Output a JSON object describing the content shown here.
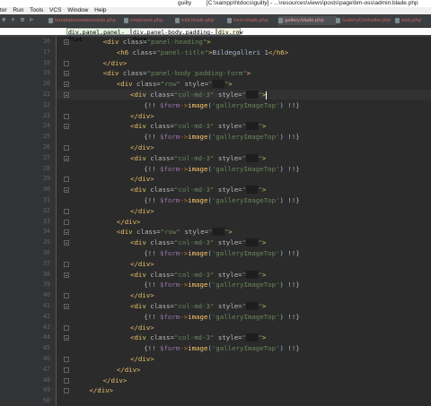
{
  "title_bar": {
    "project": "guilty",
    "path": "[C:\\xampp\\htdocs\\guilty] - ...\\resources\\views\\posts\\page\\bm-oss\\admin.blade.php"
  },
  "menu": [
    "tor",
    "Run",
    "Tools",
    "VCS",
    "Window",
    "Help"
  ],
  "tabs": [
    {
      "label": "templates/webmodule.php",
      "active": false
    },
    {
      "label": "employee.php",
      "active": false
    },
    {
      "label": "edit.blade.php",
      "active": false
    },
    {
      "label": "form.blade.php",
      "active": false
    },
    {
      "label": "gallery.blade.php",
      "active": true
    },
    {
      "label": "GalleryController.php",
      "active": false
    },
    {
      "label": "web.php",
      "active": false
    }
  ],
  "breadcrumb": [
    "div.panel.panel-flat",
    "div.panel-body.padding-form",
    "div.row"
  ],
  "lines": [
    {
      "n": "16",
      "fold": "open",
      "indent": 3,
      "parts": [
        [
          "tag",
          "<div "
        ],
        [
          "attr",
          "class="
        ],
        [
          "str",
          "\"panel-heading\""
        ],
        [
          "tag",
          ">"
        ]
      ]
    },
    {
      "n": "17",
      "fold": "",
      "indent": 4,
      "parts": [
        [
          "tag",
          "<h6 "
        ],
        [
          "attr",
          "class="
        ],
        [
          "str",
          "\"panel-title\""
        ],
        [
          "tag",
          ">"
        ],
        [
          "txt",
          "Bildegalleri 1"
        ],
        [
          "tag",
          "</h6>"
        ]
      ]
    },
    {
      "n": "18",
      "fold": "close",
      "indent": 3,
      "parts": [
        [
          "tag",
          "</div>"
        ]
      ]
    },
    {
      "n": "19",
      "fold": "open",
      "indent": 3,
      "parts": [
        [
          "tag",
          "<div "
        ],
        [
          "attr",
          "class="
        ],
        [
          "str",
          "\"panel-body padding-form\""
        ],
        [
          "tag",
          ">"
        ]
      ]
    },
    {
      "n": "20",
      "fold": "open",
      "indent": 4,
      "parts": [
        [
          "tag",
          "<div "
        ],
        [
          "attr",
          "class="
        ],
        [
          "str",
          "\"row\" "
        ],
        [
          "attr",
          "style="
        ],
        [
          "str",
          "\""
        ],
        [
          "dark",
          "███"
        ],
        [
          "str",
          "\""
        ],
        [
          "tag",
          ">"
        ]
      ]
    },
    {
      "n": "21",
      "fold": "open",
      "indent": 5,
      "cursor": true,
      "parts": [
        [
          "tag",
          "<div "
        ],
        [
          "attr",
          "class="
        ],
        [
          "str",
          "\"col-md-3\" "
        ],
        [
          "attr",
          "style="
        ],
        [
          "str",
          "\""
        ],
        [
          "dark",
          "███"
        ],
        [
          "str",
          "\""
        ],
        [
          "tag",
          ">"
        ]
      ]
    },
    {
      "n": "22",
      "fold": "",
      "indent": 6,
      "parts": [
        [
          "bang",
          "{!! "
        ],
        [
          "var",
          "$form"
        ],
        [
          "arrow",
          "->"
        ],
        [
          "fn",
          "image"
        ],
        [
          "txt",
          "("
        ],
        [
          "str",
          "'galleryImageTop'"
        ],
        [
          "txt",
          ") !!}"
        ]
      ]
    },
    {
      "n": "23",
      "fold": "close",
      "indent": 5,
      "parts": [
        [
          "tag",
          "</div>"
        ]
      ]
    },
    {
      "n": "24",
      "fold": "open",
      "indent": 5,
      "parts": [
        [
          "tag",
          "<div "
        ],
        [
          "attr",
          "class="
        ],
        [
          "str",
          "\"col-md-3\" "
        ],
        [
          "attr",
          "style="
        ],
        [
          "str",
          "\""
        ],
        [
          "dark",
          "███"
        ],
        [
          "str",
          "\""
        ],
        [
          "tag",
          ">"
        ]
      ]
    },
    {
      "n": "25",
      "fold": "",
      "indent": 6,
      "parts": [
        [
          "bang",
          "{!! "
        ],
        [
          "var",
          "$form"
        ],
        [
          "arrow",
          "->"
        ],
        [
          "fn",
          "image"
        ],
        [
          "txt",
          "("
        ],
        [
          "str",
          "'galleryImageTop'"
        ],
        [
          "txt",
          ") !!}"
        ]
      ]
    },
    {
      "n": "26",
      "fold": "close",
      "indent": 5,
      "parts": [
        [
          "tag",
          "</div>"
        ]
      ]
    },
    {
      "n": "27",
      "fold": "open",
      "indent": 5,
      "parts": [
        [
          "tag",
          "<div "
        ],
        [
          "attr",
          "class="
        ],
        [
          "str",
          "\"col-md-3\" "
        ],
        [
          "attr",
          "style="
        ],
        [
          "str",
          "\""
        ],
        [
          "dark",
          "███"
        ],
        [
          "str",
          "\""
        ],
        [
          "tag",
          ">"
        ]
      ]
    },
    {
      "n": "28",
      "fold": "",
      "indent": 6,
      "parts": [
        [
          "bang",
          "{!! "
        ],
        [
          "var",
          "$form"
        ],
        [
          "arrow",
          "->"
        ],
        [
          "fn",
          "image"
        ],
        [
          "txt",
          "("
        ],
        [
          "str",
          "'galleryImageTop'"
        ],
        [
          "txt",
          ") !!}"
        ]
      ]
    },
    {
      "n": "29",
      "fold": "close",
      "indent": 5,
      "parts": [
        [
          "tag",
          "</div>"
        ]
      ]
    },
    {
      "n": "30",
      "fold": "open",
      "indent": 5,
      "parts": [
        [
          "tag",
          "<div "
        ],
        [
          "attr",
          "class="
        ],
        [
          "str",
          "\"col-md-3\" "
        ],
        [
          "attr",
          "style="
        ],
        [
          "str",
          "\""
        ],
        [
          "dark",
          "███"
        ],
        [
          "str",
          "\""
        ],
        [
          "tag",
          ">"
        ]
      ]
    },
    {
      "n": "31",
      "fold": "",
      "indent": 6,
      "parts": [
        [
          "bang",
          "{!! "
        ],
        [
          "var",
          "$form"
        ],
        [
          "arrow",
          "->"
        ],
        [
          "fn",
          "image"
        ],
        [
          "txt",
          "("
        ],
        [
          "str",
          "'galleryImageTop'"
        ],
        [
          "txt",
          ") !!}"
        ]
      ]
    },
    {
      "n": "32",
      "fold": "close",
      "indent": 5,
      "parts": [
        [
          "tag",
          "</div>"
        ]
      ]
    },
    {
      "n": "33",
      "fold": "close",
      "indent": 4,
      "parts": [
        [
          "tag",
          "</div>"
        ]
      ]
    },
    {
      "n": "34",
      "fold": "open",
      "indent": 4,
      "parts": [
        [
          "tag",
          "<div "
        ],
        [
          "attr",
          "class="
        ],
        [
          "str",
          "\"row\" "
        ],
        [
          "attr",
          "style="
        ],
        [
          "str",
          "\""
        ],
        [
          "dark",
          "███"
        ],
        [
          "str",
          "\""
        ],
        [
          "tag",
          ">"
        ]
      ]
    },
    {
      "n": "35",
      "fold": "open",
      "indent": 5,
      "parts": [
        [
          "tag",
          "<div "
        ],
        [
          "attr",
          "class="
        ],
        [
          "str",
          "\"col-md-3\" "
        ],
        [
          "attr",
          "style="
        ],
        [
          "str",
          "\""
        ],
        [
          "dark",
          "███"
        ],
        [
          "str",
          "\""
        ],
        [
          "tag",
          ">"
        ]
      ]
    },
    {
      "n": "36",
      "fold": "",
      "indent": 6,
      "parts": [
        [
          "bang",
          "{!! "
        ],
        [
          "var",
          "$form"
        ],
        [
          "arrow",
          "->"
        ],
        [
          "fn",
          "image"
        ],
        [
          "txt",
          "("
        ],
        [
          "str",
          "'galleryImageTop'"
        ],
        [
          "txt",
          ") !!}"
        ]
      ]
    },
    {
      "n": "37",
      "fold": "close",
      "indent": 5,
      "parts": [
        [
          "tag",
          "</div>"
        ]
      ]
    },
    {
      "n": "38",
      "fold": "open",
      "indent": 5,
      "parts": [
        [
          "tag",
          "<div "
        ],
        [
          "attr",
          "class="
        ],
        [
          "str",
          "\"col-md-3\" "
        ],
        [
          "attr",
          "style="
        ],
        [
          "str",
          "\""
        ],
        [
          "dark",
          "███"
        ],
        [
          "str",
          "\""
        ],
        [
          "tag",
          ">"
        ]
      ]
    },
    {
      "n": "39",
      "fold": "",
      "indent": 6,
      "parts": [
        [
          "bang",
          "{!! "
        ],
        [
          "var",
          "$form"
        ],
        [
          "arrow",
          "->"
        ],
        [
          "fn",
          "image"
        ],
        [
          "txt",
          "("
        ],
        [
          "str",
          "'galleryImageTop'"
        ],
        [
          "txt",
          ") !!}"
        ]
      ]
    },
    {
      "n": "40",
      "fold": "close",
      "indent": 5,
      "parts": [
        [
          "tag",
          "</div>"
        ]
      ]
    },
    {
      "n": "41",
      "fold": "open",
      "indent": 5,
      "parts": [
        [
          "tag",
          "<div "
        ],
        [
          "attr",
          "class="
        ],
        [
          "str",
          "\"col-md-3\" "
        ],
        [
          "attr",
          "style="
        ],
        [
          "str",
          "\""
        ],
        [
          "dark",
          "███"
        ],
        [
          "str",
          "\""
        ],
        [
          "tag",
          ">"
        ]
      ]
    },
    {
      "n": "42",
      "fold": "",
      "indent": 6,
      "parts": [
        [
          "bang",
          "{!! "
        ],
        [
          "var",
          "$form"
        ],
        [
          "arrow",
          "->"
        ],
        [
          "fn",
          "image"
        ],
        [
          "txt",
          "("
        ],
        [
          "str",
          "'galleryImageTop'"
        ],
        [
          "txt",
          ") !!}"
        ]
      ]
    },
    {
      "n": "43",
      "fold": "close",
      "indent": 5,
      "parts": [
        [
          "tag",
          "</div>"
        ]
      ]
    },
    {
      "n": "44",
      "fold": "open",
      "indent": 5,
      "parts": [
        [
          "tag",
          "<div "
        ],
        [
          "attr",
          "class="
        ],
        [
          "str",
          "\"col-md-3\" "
        ],
        [
          "attr",
          "style="
        ],
        [
          "str",
          "\""
        ],
        [
          "dark",
          "███"
        ],
        [
          "str",
          "\""
        ],
        [
          "tag",
          ">"
        ]
      ]
    },
    {
      "n": "45",
      "fold": "",
      "indent": 6,
      "parts": [
        [
          "bang",
          "{!! "
        ],
        [
          "var",
          "$form"
        ],
        [
          "arrow",
          "->"
        ],
        [
          "fn",
          "image"
        ],
        [
          "txt",
          "("
        ],
        [
          "str",
          "'galleryImageTop'"
        ],
        [
          "txt",
          ") !!}"
        ]
      ]
    },
    {
      "n": "46",
      "fold": "close",
      "indent": 5,
      "parts": [
        [
          "tag",
          "</div>"
        ]
      ]
    },
    {
      "n": "47",
      "fold": "close",
      "indent": 4,
      "parts": [
        [
          "tag",
          "</div>"
        ]
      ]
    },
    {
      "n": "48",
      "fold": "close",
      "indent": 3,
      "parts": [
        [
          "tag",
          "</div>"
        ]
      ]
    },
    {
      "n": "49",
      "fold": "close",
      "indent": 2,
      "parts": [
        [
          "tag",
          "</div>"
        ]
      ]
    },
    {
      "n": "50",
      "fold": "",
      "indent": 0,
      "parts": []
    }
  ]
}
